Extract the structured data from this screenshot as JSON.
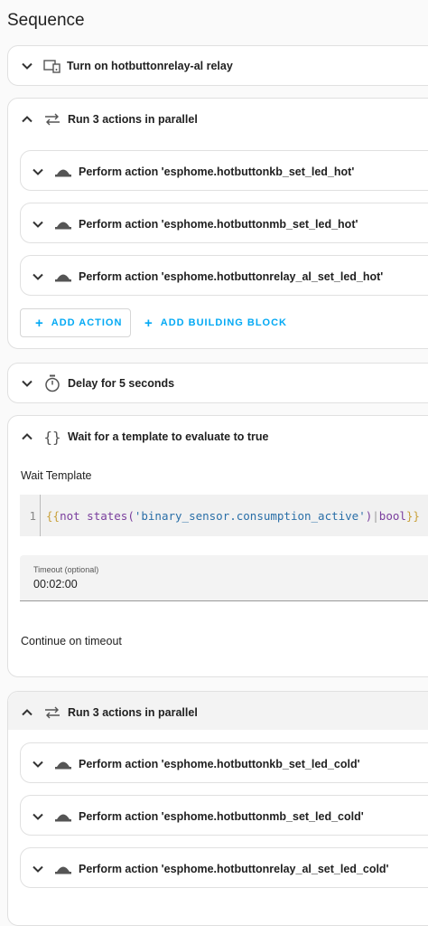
{
  "sequence_title": "Sequence",
  "items": {
    "relay": {
      "label": "Turn on hotbuttonrelay-al relay",
      "icon": "device-icon"
    },
    "parallel1": {
      "label": "Run 3 actions in parallel",
      "icon": "parallel-arrows-icon",
      "actions": [
        "Perform action 'esphome.hotbuttonkb_set_led_hot'",
        "Perform action 'esphome.hotbuttonmb_set_led_hot'",
        "Perform action 'esphome.hotbuttonrelay_al_set_led_hot'"
      ],
      "add_action": "ADD ACTION",
      "add_building_block": "ADD BUILDING BLOCK"
    },
    "delay": {
      "label": "Delay for 5 seconds",
      "icon": "timer-icon"
    },
    "wait": {
      "label": "Wait for a template to evaluate to true",
      "icon": "braces-icon",
      "template_label": "Wait Template",
      "line_number": "1",
      "code": {
        "open": "{{",
        "kw": "not",
        "fn": "states(",
        "str": "'binary_sensor.consumption_active'",
        "close_paren": ")",
        "pipe": "|",
        "filter": "bool",
        "close": "}}"
      },
      "timeout_label": "Timeout (optional)",
      "timeout_value": "00:02:00",
      "continue_label": "Continue on timeout"
    },
    "parallel2": {
      "label": "Run 3 actions in parallel",
      "icon": "parallel-arrows-icon",
      "actions": [
        "Perform action 'esphome.hotbuttonkb_set_led_cold'",
        "Perform action 'esphome.hotbuttonmb_set_led_cold'",
        "Perform action 'esphome.hotbuttonrelay_al_set_led_cold'"
      ]
    }
  },
  "colors": {
    "accent": "#03a9f4",
    "kw": "#7a3e9d",
    "str": "#2a6fa8",
    "brace": "#c9a13b"
  }
}
